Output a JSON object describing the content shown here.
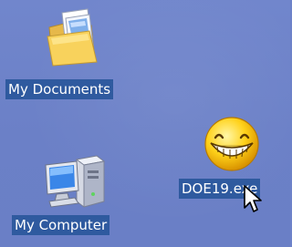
{
  "desktop": {
    "background_color": "#6d82c9",
    "selection_color": "#2f5a9f",
    "icons": [
      {
        "label": "My Documents",
        "icon": "folder-documents-icon",
        "selected": true
      },
      {
        "label": "My Computer",
        "icon": "computer-icon",
        "selected": true
      },
      {
        "label": "DOE19.exe",
        "icon": "smiley-face-icon",
        "selected": true
      }
    ]
  },
  "cursor": {
    "icon": "arrow-cursor-icon"
  }
}
